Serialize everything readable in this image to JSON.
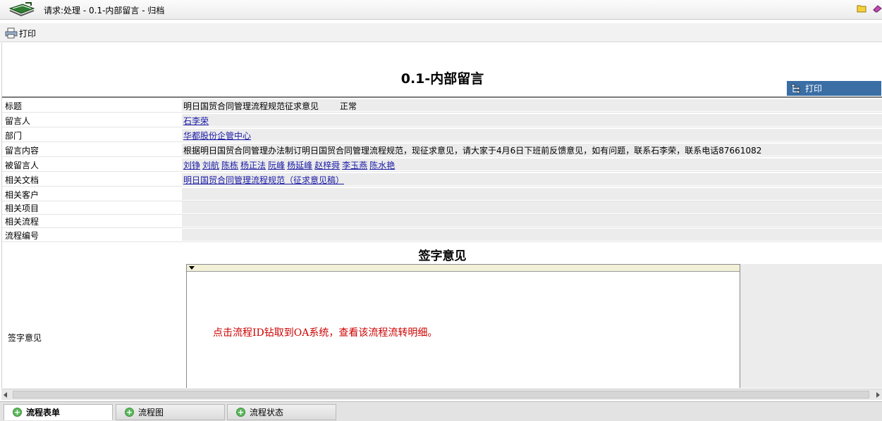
{
  "window": {
    "title": "请求:处理  - 0.1-内部留言  - 归档"
  },
  "toolbar": {
    "print_label": "打印"
  },
  "form": {
    "title_num": "0.1-",
    "title_text": "内部留言",
    "print_label": "打印",
    "fields": [
      {
        "label": "标题",
        "value": "明日国贸合同管理流程规范征求意见",
        "status": "正常"
      },
      {
        "label": "留言人",
        "links": [
          "石李荣"
        ]
      },
      {
        "label": "部门",
        "links": [
          "华都股份企管中心"
        ]
      },
      {
        "label": "留言内容",
        "value": "根据明日国贸合同管理办法制订明日国贸合同管理流程规范，现征求意见，请大家于4月6日下班前反馈意见，如有问题，联系石李荣，联系电话87661082"
      },
      {
        "label": "被留言人",
        "links": [
          "刘铮",
          "刘航",
          "陈栋",
          "杨正法",
          "阮峰",
          "杨延峰",
          "赵梓舜",
          "李玉燕",
          "陈水艳"
        ]
      },
      {
        "label": "相关文档",
        "links": [
          "明日国贸合同管理流程规范（征求意见稿）"
        ]
      },
      {
        "label": "相关客户",
        "value": ""
      },
      {
        "label": "相关项目",
        "value": ""
      },
      {
        "label": "相关流程",
        "value": ""
      },
      {
        "label": "流程编号",
        "value": ""
      }
    ],
    "sign_heading": "签字意见",
    "sign_label": "签字意见",
    "sign_note": "点击流程ID钻取到OA系统，查看该流程流转明细。"
  },
  "tabs": [
    {
      "label": "流程表单",
      "active": true
    },
    {
      "label": "流程图",
      "active": false
    },
    {
      "label": "流程状态",
      "active": false
    }
  ],
  "colors": {
    "accent_blue": "#3a6ea5",
    "link": "#1a1aa6",
    "note_red": "#cc0000",
    "tab_plus_green": "#5cb85c"
  }
}
